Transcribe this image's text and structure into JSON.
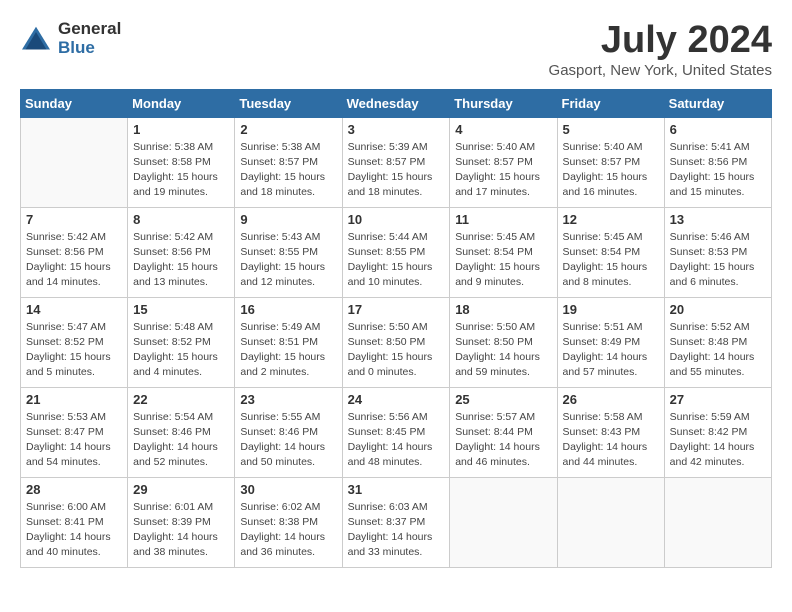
{
  "logo": {
    "general": "General",
    "blue": "Blue"
  },
  "title": "July 2024",
  "subtitle": "Gasport, New York, United States",
  "header_days": [
    "Sunday",
    "Monday",
    "Tuesday",
    "Wednesday",
    "Thursday",
    "Friday",
    "Saturday"
  ],
  "weeks": [
    [
      {
        "day": "",
        "info": ""
      },
      {
        "day": "1",
        "info": "Sunrise: 5:38 AM\nSunset: 8:58 PM\nDaylight: 15 hours and 19 minutes."
      },
      {
        "day": "2",
        "info": "Sunrise: 5:38 AM\nSunset: 8:57 PM\nDaylight: 15 hours and 18 minutes."
      },
      {
        "day": "3",
        "info": "Sunrise: 5:39 AM\nSunset: 8:57 PM\nDaylight: 15 hours and 18 minutes."
      },
      {
        "day": "4",
        "info": "Sunrise: 5:40 AM\nSunset: 8:57 PM\nDaylight: 15 hours and 17 minutes."
      },
      {
        "day": "5",
        "info": "Sunrise: 5:40 AM\nSunset: 8:57 PM\nDaylight: 15 hours and 16 minutes."
      },
      {
        "day": "6",
        "info": "Sunrise: 5:41 AM\nSunset: 8:56 PM\nDaylight: 15 hours and 15 minutes."
      }
    ],
    [
      {
        "day": "7",
        "info": "Sunrise: 5:42 AM\nSunset: 8:56 PM\nDaylight: 15 hours and 14 minutes."
      },
      {
        "day": "8",
        "info": "Sunrise: 5:42 AM\nSunset: 8:56 PM\nDaylight: 15 hours and 13 minutes."
      },
      {
        "day": "9",
        "info": "Sunrise: 5:43 AM\nSunset: 8:55 PM\nDaylight: 15 hours and 12 minutes."
      },
      {
        "day": "10",
        "info": "Sunrise: 5:44 AM\nSunset: 8:55 PM\nDaylight: 15 hours and 10 minutes."
      },
      {
        "day": "11",
        "info": "Sunrise: 5:45 AM\nSunset: 8:54 PM\nDaylight: 15 hours and 9 minutes."
      },
      {
        "day": "12",
        "info": "Sunrise: 5:45 AM\nSunset: 8:54 PM\nDaylight: 15 hours and 8 minutes."
      },
      {
        "day": "13",
        "info": "Sunrise: 5:46 AM\nSunset: 8:53 PM\nDaylight: 15 hours and 6 minutes."
      }
    ],
    [
      {
        "day": "14",
        "info": "Sunrise: 5:47 AM\nSunset: 8:52 PM\nDaylight: 15 hours and 5 minutes."
      },
      {
        "day": "15",
        "info": "Sunrise: 5:48 AM\nSunset: 8:52 PM\nDaylight: 15 hours and 4 minutes."
      },
      {
        "day": "16",
        "info": "Sunrise: 5:49 AM\nSunset: 8:51 PM\nDaylight: 15 hours and 2 minutes."
      },
      {
        "day": "17",
        "info": "Sunrise: 5:50 AM\nSunset: 8:50 PM\nDaylight: 15 hours and 0 minutes."
      },
      {
        "day": "18",
        "info": "Sunrise: 5:50 AM\nSunset: 8:50 PM\nDaylight: 14 hours and 59 minutes."
      },
      {
        "day": "19",
        "info": "Sunrise: 5:51 AM\nSunset: 8:49 PM\nDaylight: 14 hours and 57 minutes."
      },
      {
        "day": "20",
        "info": "Sunrise: 5:52 AM\nSunset: 8:48 PM\nDaylight: 14 hours and 55 minutes."
      }
    ],
    [
      {
        "day": "21",
        "info": "Sunrise: 5:53 AM\nSunset: 8:47 PM\nDaylight: 14 hours and 54 minutes."
      },
      {
        "day": "22",
        "info": "Sunrise: 5:54 AM\nSunset: 8:46 PM\nDaylight: 14 hours and 52 minutes."
      },
      {
        "day": "23",
        "info": "Sunrise: 5:55 AM\nSunset: 8:46 PM\nDaylight: 14 hours and 50 minutes."
      },
      {
        "day": "24",
        "info": "Sunrise: 5:56 AM\nSunset: 8:45 PM\nDaylight: 14 hours and 48 minutes."
      },
      {
        "day": "25",
        "info": "Sunrise: 5:57 AM\nSunset: 8:44 PM\nDaylight: 14 hours and 46 minutes."
      },
      {
        "day": "26",
        "info": "Sunrise: 5:58 AM\nSunset: 8:43 PM\nDaylight: 14 hours and 44 minutes."
      },
      {
        "day": "27",
        "info": "Sunrise: 5:59 AM\nSunset: 8:42 PM\nDaylight: 14 hours and 42 minutes."
      }
    ],
    [
      {
        "day": "28",
        "info": "Sunrise: 6:00 AM\nSunset: 8:41 PM\nDaylight: 14 hours and 40 minutes."
      },
      {
        "day": "29",
        "info": "Sunrise: 6:01 AM\nSunset: 8:39 PM\nDaylight: 14 hours and 38 minutes."
      },
      {
        "day": "30",
        "info": "Sunrise: 6:02 AM\nSunset: 8:38 PM\nDaylight: 14 hours and 36 minutes."
      },
      {
        "day": "31",
        "info": "Sunrise: 6:03 AM\nSunset: 8:37 PM\nDaylight: 14 hours and 33 minutes."
      },
      {
        "day": "",
        "info": ""
      },
      {
        "day": "",
        "info": ""
      },
      {
        "day": "",
        "info": ""
      }
    ]
  ]
}
